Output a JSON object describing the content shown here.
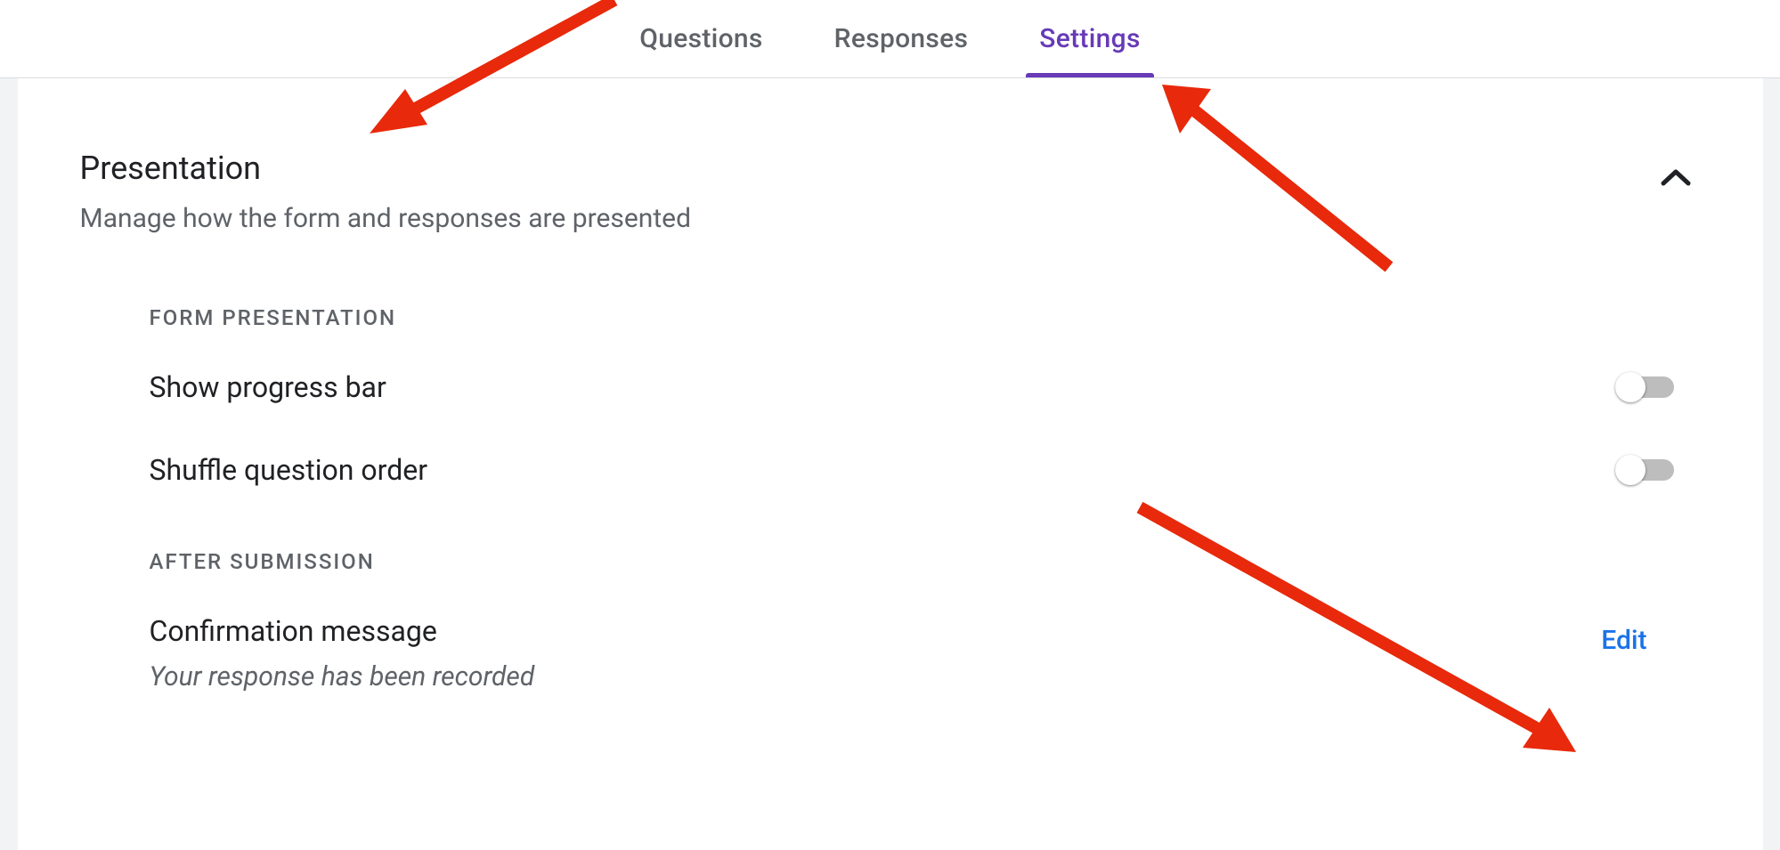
{
  "tabs": {
    "questions": "Questions",
    "responses": "Responses",
    "settings": "Settings",
    "active": "settings"
  },
  "presentation": {
    "title": "Presentation",
    "subtitle": "Manage how the form and responses are presented"
  },
  "form_presentation": {
    "label": "FORM PRESENTATION",
    "show_progress_bar": {
      "label": "Show progress bar",
      "enabled": false
    },
    "shuffle_question_order": {
      "label": "Shuffle question order",
      "enabled": false
    }
  },
  "after_submission": {
    "label": "AFTER SUBMISSION",
    "confirmation_message": {
      "title": "Confirmation message",
      "value": "Your response has been recorded",
      "edit_label": "Edit"
    }
  }
}
